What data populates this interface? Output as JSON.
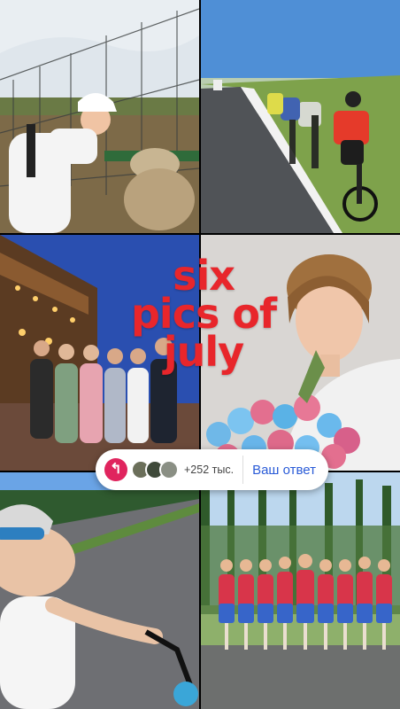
{
  "story": {
    "title_lines": [
      "six",
      "pics of",
      "july"
    ],
    "title_color": "#e8262b"
  },
  "reply_bar": {
    "share_icon": "reply-arrow-icon",
    "viewers_count": "+252 тыс.",
    "reply_label": "Ваш ответ",
    "accent": "#e0245e",
    "link_color": "#2a5bd7"
  }
}
